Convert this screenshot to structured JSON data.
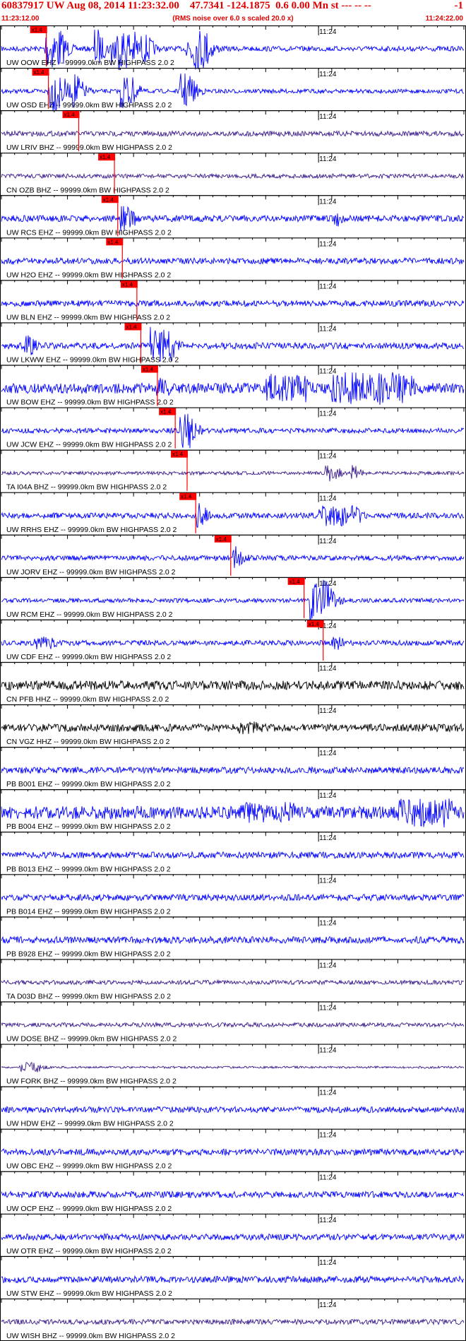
{
  "header": {
    "title": "60837917 UW Aug 08, 2014 11:23:32.00    47.7341 -124.1875  0.6 0.00 Mn st --- -- --",
    "title_suffix": "-1",
    "start_time": "11:23:12.00",
    "note": "(RMS noise over 6.0 s scaled 20.0 x)",
    "end_time": "11:24:22.00"
  },
  "colors": {
    "header_text": "#e00000",
    "trace_default": "#0000ff",
    "trace_black": "#000000",
    "trace_purple": "#3a1a8c",
    "pick_marker": "#ff0000",
    "axis": "#000000"
  },
  "chart_data": {
    "type": "seismogram",
    "time_range": [
      "11:23:12.00",
      "11:24:22.00"
    ],
    "minute_label": "11:24",
    "pick_label": "x1.4",
    "traces": [
      {
        "label": "UW OOW EHZ -- 99999.0km BW  HIGHPASS  2.0  2",
        "color": "blue",
        "pick_sec": 6.7,
        "noise": 0.12,
        "events": [
          {
            "t": 6.5,
            "d": 2.5,
            "a": 1.0
          },
          {
            "t": 14.0,
            "d": 0.6,
            "a": 1.0
          },
          {
            "t": 16.5,
            "d": 3.5,
            "a": 1.0
          },
          {
            "t": 21.0,
            "d": 1.2,
            "a": 0.7
          },
          {
            "t": 28.0,
            "d": 3.0,
            "a": 1.0
          }
        ]
      },
      {
        "label": "UW OSD EHZ -- 99999.0km BW  HIGHPASS  2.0  2",
        "color": "blue",
        "pick_sec": 7.0,
        "noise": 0.1,
        "events": [
          {
            "t": 7.0,
            "d": 2.0,
            "a": 1.0
          },
          {
            "t": 10.5,
            "d": 1.0,
            "a": 0.9
          },
          {
            "t": 18.0,
            "d": 1.5,
            "a": 0.9
          },
          {
            "t": 27.0,
            "d": 1.5,
            "a": 0.9
          }
        ]
      },
      {
        "label": "UW LRIV BHZ -- 99999.0km BW  HIGHPASS  2.0  2",
        "color": "purple",
        "pick_sec": 11.6,
        "noise": 0.12,
        "events": []
      },
      {
        "label": "CN OZB BHZ -- 99999.0km BW  HIGHPASS  2.0  2",
        "color": "purple",
        "pick_sec": 17.0,
        "noise": 0.1,
        "events": []
      },
      {
        "label": "UW RCS EHZ -- 99999.0km BW  HIGHPASS  2.0  2",
        "color": "blue",
        "pick_sec": 17.5,
        "noise": 0.15,
        "events": [
          {
            "t": 18.0,
            "d": 1.5,
            "a": 0.6
          },
          {
            "t": 50.0,
            "d": 1.0,
            "a": 0.4
          }
        ]
      },
      {
        "label": "UW H2O EHZ -- 99999.0km BW  HIGHPASS  2.0  2",
        "color": "blue",
        "pick_sec": 18.2,
        "noise": 0.14,
        "events": []
      },
      {
        "label": "UW BLN EHZ -- 99999.0km BW  HIGHPASS  2.0  2",
        "color": "blue",
        "pick_sec": 20.4,
        "noise": 0.14,
        "events": []
      },
      {
        "label": "UW LKWW EHZ -- 99999.0km BW  HIGHPASS  2.0  2",
        "color": "blue",
        "pick_sec": 21.0,
        "noise": 0.15,
        "events": [
          {
            "t": 3.5,
            "d": 1.0,
            "a": 0.5
          },
          {
            "t": 22.5,
            "d": 3.0,
            "a": 0.9
          }
        ]
      },
      {
        "label": "UW BOW EHZ -- 99999.0km BW  HIGHPASS  2.0  2",
        "color": "blue",
        "pick_sec": 23.5,
        "noise": 0.25,
        "events": [
          {
            "t": 23.5,
            "d": 1.5,
            "a": 0.5
          },
          {
            "t": 40.0,
            "d": 6.0,
            "a": 0.7
          },
          {
            "t": 50.0,
            "d": 12.0,
            "a": 0.8
          }
        ]
      },
      {
        "label": "UW JCW EHZ -- 99999.0km BW  HIGHPASS  2.0  2",
        "color": "blue",
        "pick_sec": 26.2,
        "noise": 0.12,
        "events": [
          {
            "t": 27.0,
            "d": 1.5,
            "a": 0.9
          }
        ]
      },
      {
        "label": "TA I04A BHZ -- 99999.0km BW  HIGHPASS  2.0  2",
        "color": "purple",
        "pick_sec": 28.0,
        "noise": 0.08,
        "events": [
          {
            "t": 49.0,
            "d": 1.5,
            "a": 0.4
          },
          {
            "t": 53.0,
            "d": 0.5,
            "a": 0.4
          }
        ]
      },
      {
        "label": "UW RRHS EHZ -- 99999.0km BW  HIGHPASS  2.0  2",
        "color": "blue",
        "pick_sec": 29.3,
        "noise": 0.13,
        "events": [
          {
            "t": 29.5,
            "d": 1.0,
            "a": 0.6
          },
          {
            "t": 48.0,
            "d": 6.0,
            "a": 0.5
          }
        ]
      },
      {
        "label": "UW JORV EHZ -- 99999.0km BW  HIGHPASS  2.0  2",
        "color": "blue",
        "pick_sec": 34.6,
        "noise": 0.12,
        "events": [
          {
            "t": 35.0,
            "d": 1.0,
            "a": 0.6
          }
        ]
      },
      {
        "label": "UW RCM EHZ -- 99999.0km BW  HIGHPASS  2.0  2",
        "color": "blue",
        "pick_sec": 45.7,
        "noise": 0.1,
        "events": [
          {
            "t": 46.5,
            "d": 3.0,
            "a": 1.0
          }
        ]
      },
      {
        "label": "UW CDF EHZ -- 99999.0km BW  HIGHPASS  2.0  2",
        "color": "blue",
        "pick_sec": 48.6,
        "noise": 0.12,
        "events": [
          {
            "t": 5.0,
            "d": 3.0,
            "a": 0.3
          },
          {
            "t": 50.0,
            "d": 1.0,
            "a": 0.4
          }
        ]
      },
      {
        "label": "CN PFB HHZ -- 99999.0km BW  HIGHPASS  2.0  2",
        "color": "black",
        "pick_sec": null,
        "noise": 0.22,
        "events": []
      },
      {
        "label": "CN VGZ HHZ -- 99999.0km BW  HIGHPASS  2.0  2",
        "color": "black",
        "pick_sec": null,
        "noise": 0.18,
        "events": [
          {
            "t": 36.0,
            "d": 3.0,
            "a": 0.3
          }
        ]
      },
      {
        "label": "PB B001 EHZ -- 99999.0km BW  HIGHPASS  2.0  2",
        "color": "blue",
        "pick_sec": null,
        "noise": 0.15,
        "events": []
      },
      {
        "label": "PB B004 EHZ -- 99999.0km BW  HIGHPASS  2.0  2",
        "color": "blue",
        "pick_sec": null,
        "noise": 0.3,
        "events": [
          {
            "t": 35.0,
            "d": 10.0,
            "a": 0.5
          },
          {
            "t": 60.0,
            "d": 8.0,
            "a": 0.7
          }
        ]
      },
      {
        "label": "PB B013 EHZ -- 99999.0km BW  HIGHPASS  2.0  2",
        "color": "blue",
        "pick_sec": null,
        "noise": 0.15,
        "events": []
      },
      {
        "label": "PB B014 EHZ -- 99999.0km BW  HIGHPASS  2.0  2",
        "color": "blue",
        "pick_sec": null,
        "noise": 0.15,
        "events": []
      },
      {
        "label": "PB B928 EHZ -- 99999.0km BW  HIGHPASS  2.0  2",
        "color": "blue",
        "pick_sec": null,
        "noise": 0.16,
        "events": []
      },
      {
        "label": "TA D03D BHZ -- 99999.0km BW  HIGHPASS  2.0  2",
        "color": "purple",
        "pick_sec": null,
        "noise": 0.1,
        "events": []
      },
      {
        "label": "UW DOSE BHZ -- 99999.0km BW  HIGHPASS  2.0  2",
        "color": "purple",
        "pick_sec": null,
        "noise": 0.1,
        "events": []
      },
      {
        "label": "UW FORK BHZ -- 99999.0km BW  HIGHPASS  2.0  2",
        "color": "purple",
        "pick_sec": null,
        "noise": 0.05,
        "events": [
          {
            "t": 2.5,
            "d": 3.0,
            "a": 0.25
          }
        ]
      },
      {
        "label": "UW HDW EHZ -- 99999.0km BW  HIGHPASS  2.0  2",
        "color": "blue",
        "pick_sec": null,
        "noise": 0.14,
        "events": []
      },
      {
        "label": "UW OBC EHZ -- 99999.0km BW  HIGHPASS  2.0  2",
        "color": "blue",
        "pick_sec": null,
        "noise": 0.15,
        "events": []
      },
      {
        "label": "UW OCP EHZ -- 99999.0km BW  HIGHPASS  2.0  2",
        "color": "blue",
        "pick_sec": null,
        "noise": 0.15,
        "events": []
      },
      {
        "label": "UW OTR EHZ -- 99999.0km BW  HIGHPASS  2.0  2",
        "color": "blue",
        "pick_sec": null,
        "noise": 0.15,
        "events": []
      },
      {
        "label": "UW STW EHZ -- 99999.0km BW  HIGHPASS  2.0  2",
        "color": "blue",
        "pick_sec": null,
        "noise": 0.15,
        "events": []
      },
      {
        "label": "UW WISH BHZ -- 99999.0km BW  HIGHPASS  2.0  2",
        "color": "purple",
        "pick_sec": null,
        "noise": 0.12,
        "events": []
      }
    ]
  }
}
